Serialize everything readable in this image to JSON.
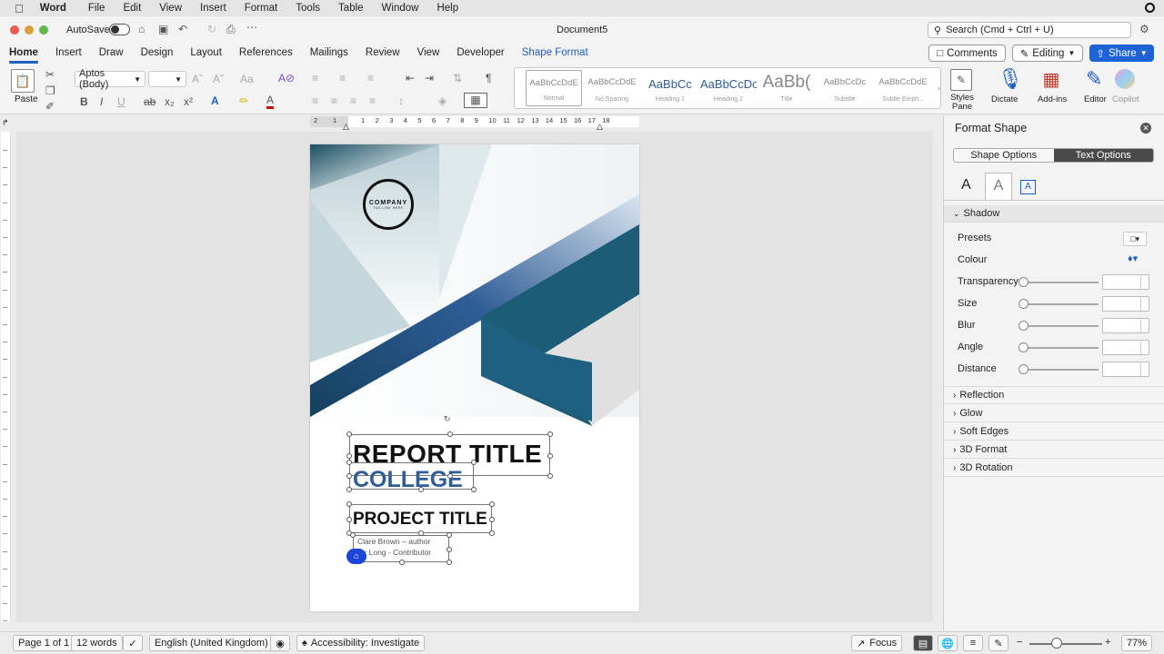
{
  "menubar": {
    "app": "Word",
    "items": [
      "File",
      "Edit",
      "View",
      "Insert",
      "Format",
      "Tools",
      "Table",
      "Window",
      "Help"
    ]
  },
  "titlebar": {
    "autosave": "AutoSave",
    "doc_title": "Document5",
    "search_placeholder": "Search (Cmd + Ctrl + U)"
  },
  "tabs": [
    "Home",
    "Insert",
    "Draw",
    "Design",
    "Layout",
    "References",
    "Mailings",
    "Review",
    "View",
    "Developer",
    "Shape Format"
  ],
  "actions": {
    "comments": "Comments",
    "editing": "Editing",
    "share": "Share"
  },
  "ribbon": {
    "paste": "Paste",
    "font_name": "Aptos (Body)",
    "styles": [
      {
        "preview": "AaBbCcDdE",
        "name": "Normal"
      },
      {
        "preview": "AaBbCcDdE",
        "name": "No Spacing"
      },
      {
        "preview": "AaBbCc",
        "name": "Heading 1"
      },
      {
        "preview": "AaBbCcDc",
        "name": "Heading 2"
      },
      {
        "preview": "AaBb(",
        "name": "Title"
      },
      {
        "preview": "AaBbCcDc",
        "name": "Subtitle"
      },
      {
        "preview": "AaBbCcDdE",
        "name": "Subtle Emph..."
      }
    ],
    "styles_pane": "Styles Pane",
    "dictate": "Dictate",
    "addins": "Add-ins",
    "editor": "Editor",
    "copilot": "Copilot"
  },
  "ruler": [
    "2",
    "1",
    "1",
    "2",
    "3",
    "4",
    "5",
    "6",
    "7",
    "8",
    "9",
    "10",
    "11",
    "12",
    "13",
    "14",
    "15",
    "16",
    "17",
    "18"
  ],
  "document": {
    "logo_main": "COMPANY",
    "logo_sub": "TAG LINE HERE",
    "report_title": "REPORT TITLE",
    "college": "COLLEGE",
    "project_title": "PROJECT TITLE",
    "author_line1": "Clare Brown – author",
    "author_line2": "x Long - Contributor"
  },
  "pane": {
    "title": "Format Shape",
    "tab_shape": "Shape Options",
    "tab_text": "Text Options",
    "section_shadow": "Shadow",
    "presets": "Presets",
    "colour": "Colour",
    "sliders": [
      "Transparency",
      "Size",
      "Blur",
      "Angle",
      "Distance"
    ],
    "sections": [
      "Reflection",
      "Glow",
      "Soft Edges",
      "3D Format",
      "3D Rotation"
    ]
  },
  "status": {
    "page": "Page 1 of 1",
    "words": "12 words",
    "language": "English (United Kingdom)",
    "accessibility": "Accessibility: Investigate",
    "focus": "Focus",
    "zoom": "77%"
  },
  "colors": {
    "accent": "#1f5fbf",
    "share_bg": "#1e63d6",
    "band_dark": "#174a7a",
    "band_teal": "#1d5c77"
  }
}
